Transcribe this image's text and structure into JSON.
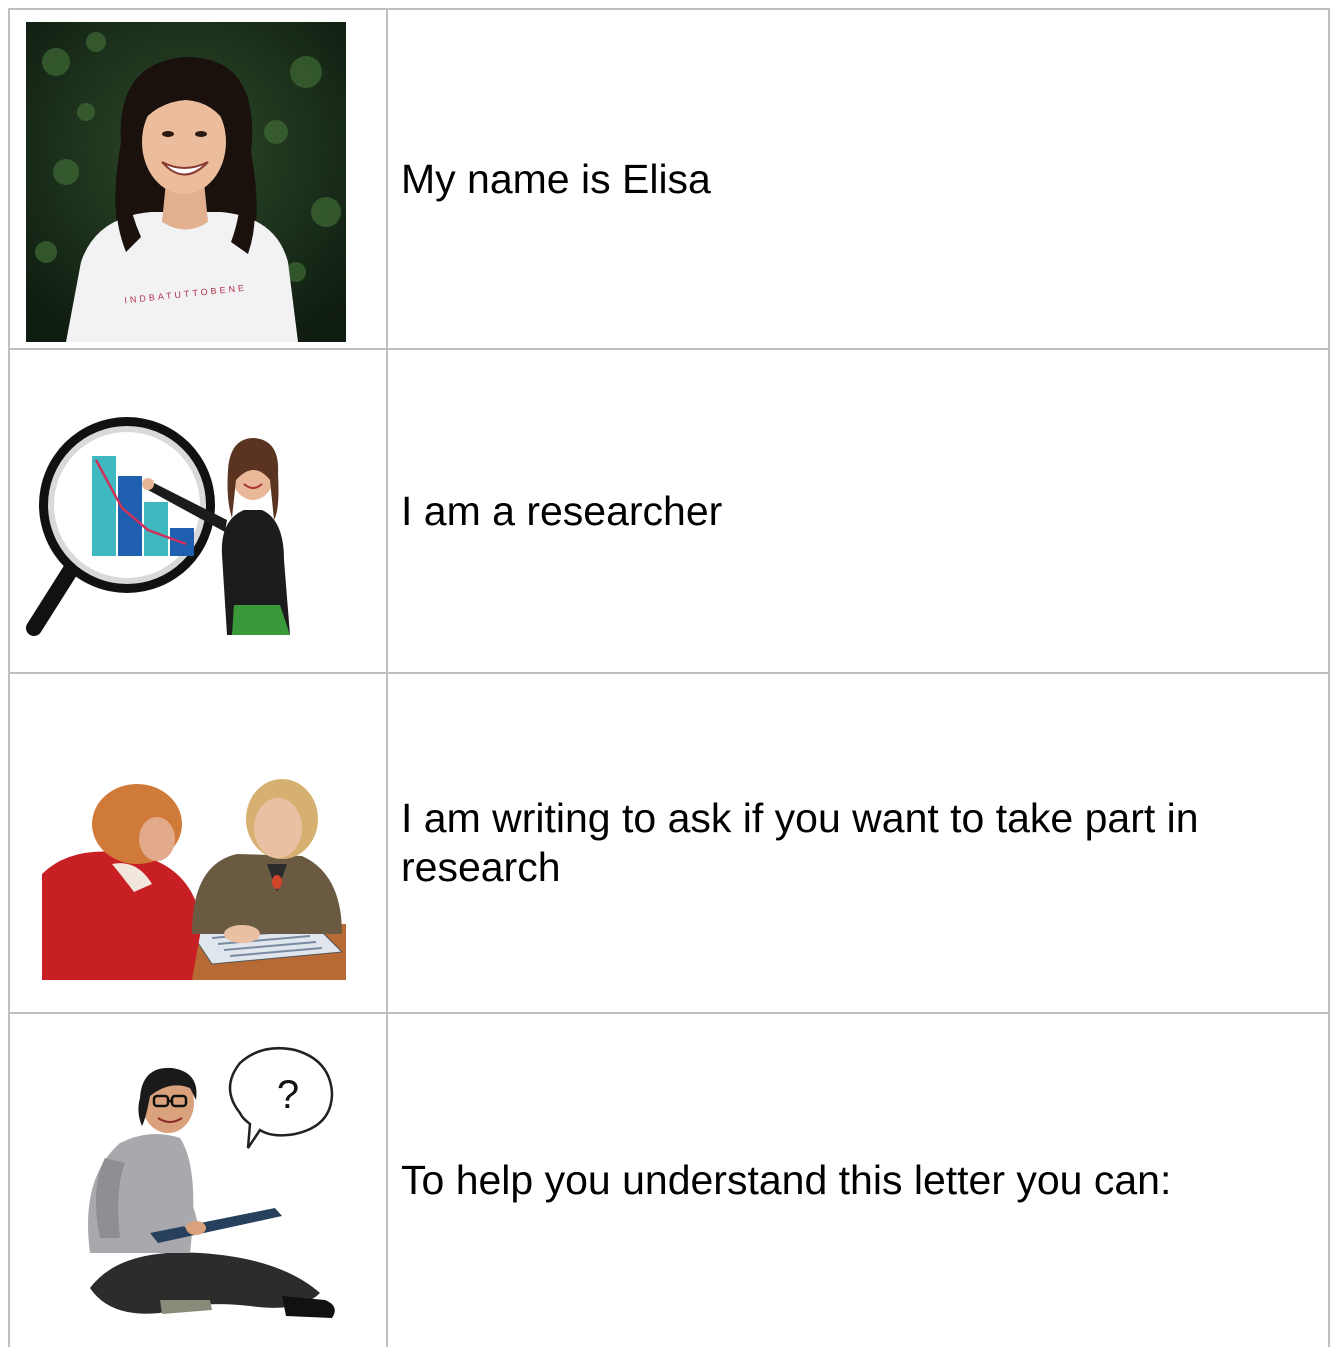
{
  "rows": [
    {
      "text": "My name is Elisa",
      "image": "portrait-photo"
    },
    {
      "text": "I am a researcher",
      "image": "researcher-magnifier-chart-icon"
    },
    {
      "text": "I am writing to ask if you want to take part in research",
      "image": "two-women-reading-document-photo"
    },
    {
      "text": "To help you understand this letter you can:",
      "image": "woman-with-question-bubble-icon"
    }
  ],
  "tshirt_print": "INDBATUTTOBENE",
  "question_mark": "?",
  "colors": {
    "border": "#bfbfbf",
    "text": "#000000",
    "chart_teal": "#3fb8c0",
    "chart_blue": "#1f5fb0",
    "chart_line": "#d0305a"
  }
}
